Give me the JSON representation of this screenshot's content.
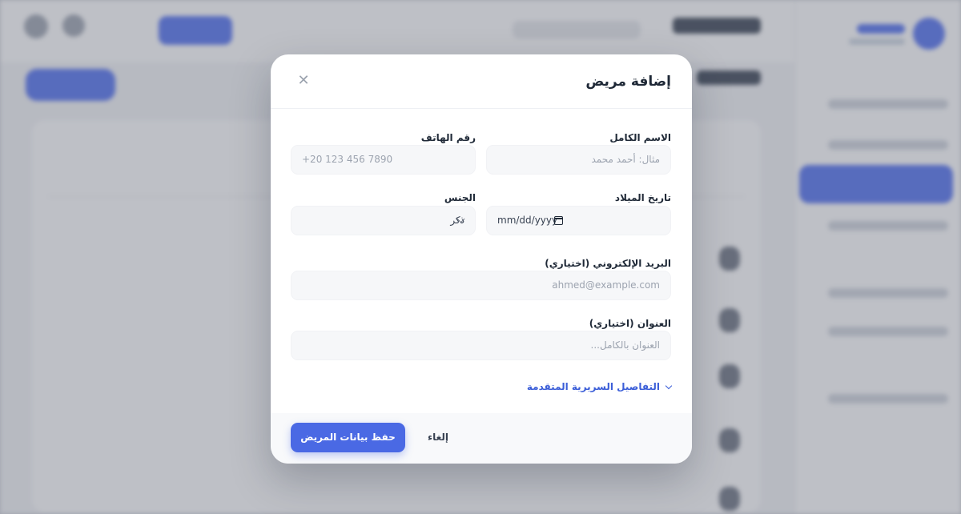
{
  "modal": {
    "title": "إضافة مريض",
    "fields": {
      "full_name": {
        "label": "الاسم الكامل",
        "placeholder": "مثال: أحمد محمد"
      },
      "phone": {
        "label": "رقم الهاتف",
        "placeholder": "+20 123 456 7890"
      },
      "birth_date": {
        "label": "تاريخ الميلاد",
        "value": "mm/dd/yyyy"
      },
      "gender": {
        "label": "الجنس",
        "value": "ذكر"
      },
      "email": {
        "label": "البريد الإلكتروني (اختياري)",
        "placeholder": "ahmed@example.com"
      },
      "address": {
        "label": "العنوان (اختياري)",
        "placeholder": "العنوان بالكامل..."
      }
    },
    "advanced_toggle": "التفاصيل السريرية المتقدمة",
    "footer": {
      "save_label": "حفظ بيانات المريض",
      "cancel_label": "إلغاء"
    }
  },
  "colors": {
    "primary": "#4a69e4",
    "link": "#3b5ed8",
    "field_bg": "#f6f7f9"
  },
  "icons": {
    "close": "close-icon",
    "calendar": "calendar-icon",
    "gender_dropdown": "chevron-down-icon",
    "advanced": "chevron-down-icon"
  }
}
